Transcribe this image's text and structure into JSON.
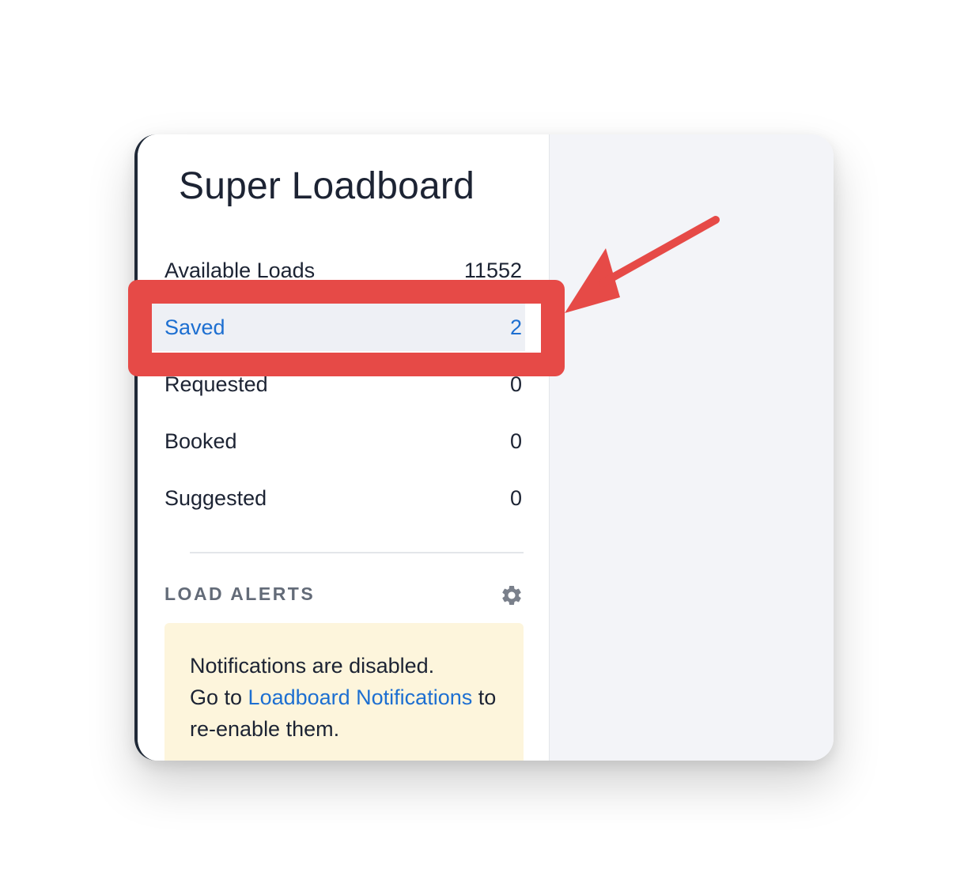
{
  "app": {
    "title": "Super Loadboard"
  },
  "nav": {
    "items": [
      {
        "label": "Available Loads",
        "count": "11552"
      },
      {
        "label": "Saved",
        "count": "2",
        "active": true
      },
      {
        "label": "Requested",
        "count": "0"
      },
      {
        "label": "Booked",
        "count": "0"
      },
      {
        "label": "Suggested",
        "count": "0"
      }
    ]
  },
  "alerts": {
    "heading": "LOAD ALERTS",
    "settings_icon": "gear-icon",
    "notice": {
      "line1": "Notifications are disabled.",
      "prefix": "Go to ",
      "link_text": "Loadboard Notifications",
      "suffix": " to re-enable them."
    }
  },
  "annotation": {
    "highlight_color": "#e64a47",
    "arrow_icon": "arrow-pointer-icon"
  },
  "colors": {
    "accent": "#1d6fd1",
    "active_bg": "#eef0f5",
    "notice_bg": "#fdf5dc"
  }
}
